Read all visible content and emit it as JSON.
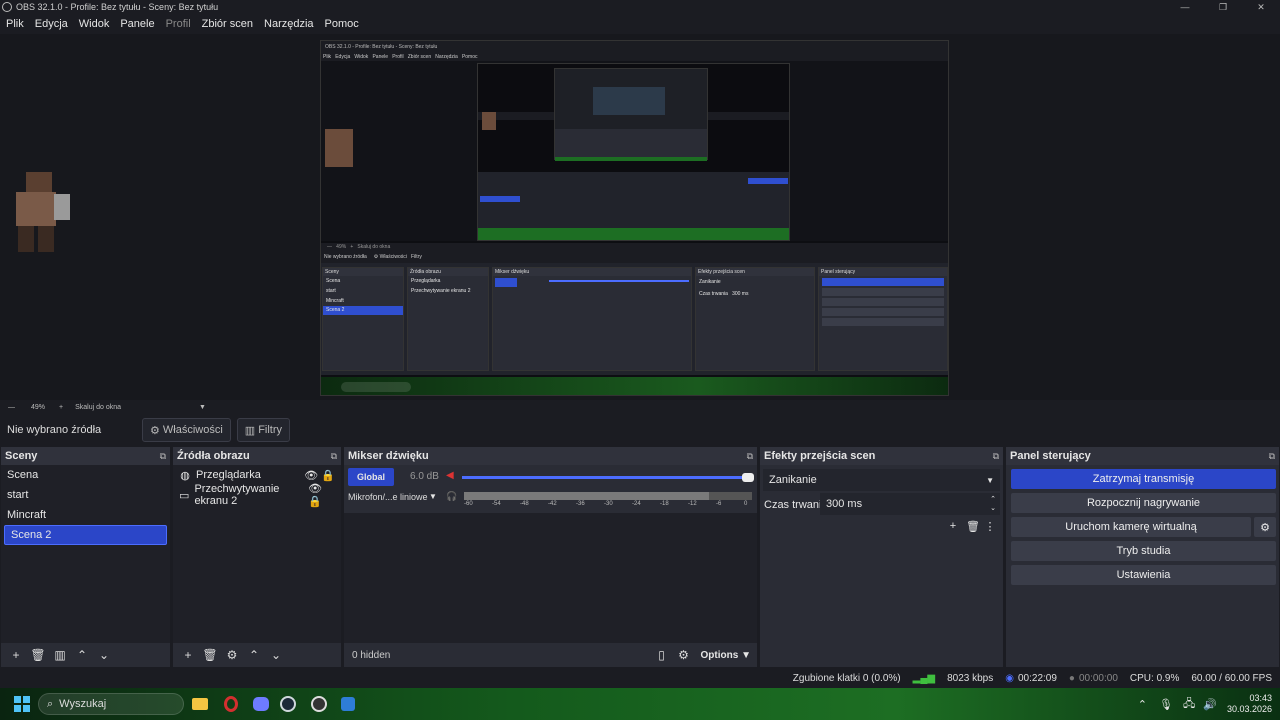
{
  "window": {
    "title": "OBS 32.1.0 - Profile: Bez tytułu - Sceny: Bez tytułu"
  },
  "menu": [
    "Plik",
    "Edycja",
    "Widok",
    "Panele",
    "Profil",
    "Zbiór scen",
    "Narzędzia",
    "Pomoc"
  ],
  "preview_status": {
    "zoom": "49%",
    "scale_mode": "Skaluj do okna"
  },
  "source_toolbar": {
    "no_source": "Nie wybrano źródła",
    "properties": "Właściwości",
    "filters": "Filtry"
  },
  "scenes": {
    "title": "Sceny",
    "items": [
      "Scena",
      "start",
      "Mincraft",
      "Scena 2"
    ],
    "selected": "Scena 2"
  },
  "sources": {
    "title": "Źródła obrazu",
    "items": [
      "Przeglądarka",
      "Przechwytywanie ekranu 2"
    ]
  },
  "mixer": {
    "title": "Mikser dźwięku",
    "global_label": "Global",
    "global_db": "6.0 dB",
    "mic_label": "Mikrofon/...e liniowe",
    "ticks": [
      "-60",
      "-54",
      "-48",
      "-42",
      "-36",
      "-30",
      "-24",
      "-18",
      "-12",
      "-6",
      "0"
    ],
    "hidden": "0 hidden",
    "options": "Options",
    "global_level": 1.0
  },
  "transitions": {
    "title": "Efekty przejścia scen",
    "selected": "Zanikanie",
    "duration_label": "Czas trwania",
    "duration": "300 ms"
  },
  "controls": {
    "title": "Panel sterujący",
    "stop_stream": "Zatrzymaj transmisję",
    "start_record": "Rozpocznij nagrywanie",
    "virtual_cam": "Uruchom kamerę wirtualną",
    "studio": "Tryb studia",
    "settings": "Ustawienia"
  },
  "status": {
    "dropped": "Zgubione klatki 0 (0.0%)",
    "bitrate": "8023 kbps",
    "stream_time": "00:22:09",
    "rec_time": "00:00:00",
    "cpu": "CPU: 0.9%",
    "fps": "60.00 / 60.00 FPS"
  },
  "taskbar": {
    "search": "Wyszukaj",
    "time": "03:43",
    "date": "30.03.2026"
  },
  "colors": {
    "accent": "#2b46c8",
    "background": "#1b1c22",
    "dock": "#2a2c35"
  }
}
